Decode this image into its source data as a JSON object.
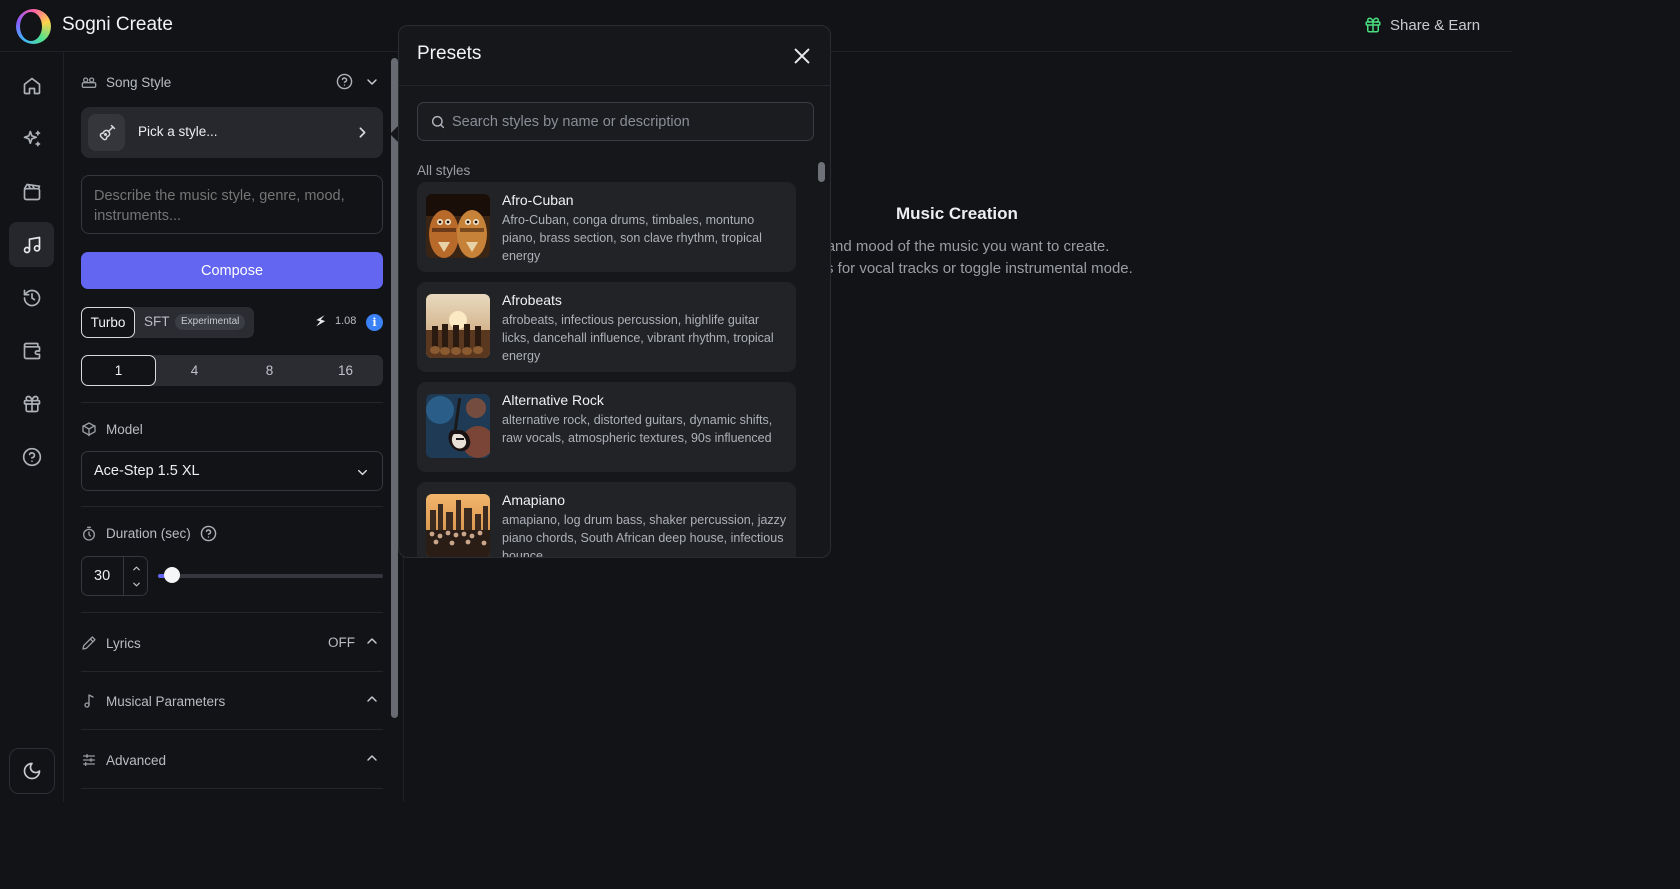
{
  "app": {
    "title": "Sogni Create",
    "share_label": "Share & Earn"
  },
  "rail": [
    "home-icon",
    "sparkles-icon",
    "film-icon",
    "music-icon",
    "history-icon",
    "wallet-icon",
    "gift-icon",
    "help-icon",
    "moon-icon"
  ],
  "controls": {
    "song_style_label": "Song Style",
    "pick_style_label": "Pick a style...",
    "describe_placeholder": "Describe the music style, genre, mood, instruments...",
    "compose_label": "Compose",
    "modes": {
      "turbo": "Turbo",
      "sft": "SFT",
      "experimental": "Experimental",
      "selected": "Turbo"
    },
    "cost": "1.08",
    "counts": [
      "1",
      "4",
      "8",
      "16"
    ],
    "count_selected": "1",
    "model_label": "Model",
    "model_value": "Ace-Step 1.5 XL",
    "duration_label": "Duration (sec)",
    "duration_value": "30",
    "duration_level": 0.06,
    "lyrics_label": "Lyrics",
    "lyrics_state": "OFF",
    "musical_params_label": "Musical Parameters",
    "advanced_label": "Advanced"
  },
  "main": {
    "title": "Music Creation",
    "desc_line1": "le, genre, and mood of the music you want to create.",
    "desc_line2": "s for vocal tracks or toggle instrumental mode."
  },
  "presets": {
    "title": "Presets",
    "search_placeholder": "Search styles by name or description",
    "section_label": "All styles",
    "items": [
      {
        "name": "Afro-Cuban",
        "desc": "Afro-Cuban, conga drums, timbales, montuno piano, brass section, son clave rhythm, tropical energy"
      },
      {
        "name": "Afrobeats",
        "desc": "afrobeats, infectious percussion, highlife guitar licks, dancehall influence, vibrant rhythm, tropical energy"
      },
      {
        "name": "Alternative Rock",
        "desc": "alternative rock, distorted guitars, dynamic shifts, raw vocals, atmospheric textures, 90s influenced"
      },
      {
        "name": "Amapiano",
        "desc": "amapiano, log drum bass, shaker percussion, jazzy piano chords, South African deep house, infectious bounce"
      }
    ]
  },
  "colors": {
    "accent": "#6366f1",
    "info": "#3b82f6",
    "gift": "#4ade80",
    "background": "#121316"
  }
}
